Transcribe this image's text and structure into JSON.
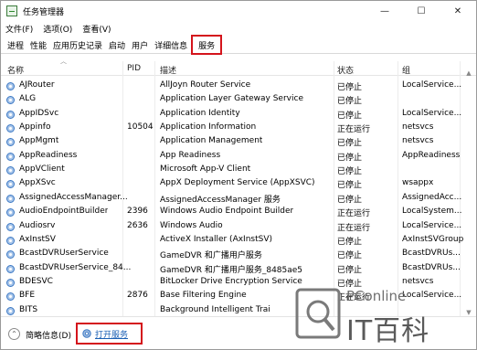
{
  "window": {
    "title": "任务管理器",
    "controls": [
      "—",
      "☐",
      "✕"
    ]
  },
  "menu": [
    "文件(F)",
    "选项(O)",
    "查看(V)"
  ],
  "tabs": [
    {
      "label": "进程",
      "active": false
    },
    {
      "label": "性能",
      "active": false
    },
    {
      "label": "应用历史记录",
      "active": false
    },
    {
      "label": "启动",
      "active": false
    },
    {
      "label": "用户",
      "active": false
    },
    {
      "label": "详细信息",
      "active": false
    },
    {
      "label": "服务",
      "active": true
    }
  ],
  "columns": {
    "name": "名称",
    "pid": "PID",
    "desc": "描述",
    "status": "状态",
    "group": "组"
  },
  "rows": [
    {
      "name": "AJRouter",
      "pid": "",
      "desc": "AllJoyn Router Service",
      "status": "已停止",
      "group": "LocalService..."
    },
    {
      "name": "ALG",
      "pid": "",
      "desc": "Application Layer Gateway Service",
      "status": "已停止",
      "group": ""
    },
    {
      "name": "AppIDSvc",
      "pid": "",
      "desc": "Application Identity",
      "status": "已停止",
      "group": "LocalService..."
    },
    {
      "name": "Appinfo",
      "pid": "10504",
      "desc": "Application Information",
      "status": "正在运行",
      "group": "netsvcs"
    },
    {
      "name": "AppMgmt",
      "pid": "",
      "desc": "Application Management",
      "status": "已停止",
      "group": "netsvcs"
    },
    {
      "name": "AppReadiness",
      "pid": "",
      "desc": "App Readiness",
      "status": "已停止",
      "group": "AppReadiness"
    },
    {
      "name": "AppVClient",
      "pid": "",
      "desc": "Microsoft App-V Client",
      "status": "已停止",
      "group": ""
    },
    {
      "name": "AppXSvc",
      "pid": "",
      "desc": "AppX Deployment Service (AppXSVC)",
      "status": "已停止",
      "group": "wsappx"
    },
    {
      "name": "AssignedAccessManager...",
      "pid": "",
      "desc": "AssignedAccessManager 服务",
      "status": "已停止",
      "group": "AssignedAcc..."
    },
    {
      "name": "AudioEndpointBuilder",
      "pid": "2396",
      "desc": "Windows Audio Endpoint Builder",
      "status": "正在运行",
      "group": "LocalSystem..."
    },
    {
      "name": "Audiosrv",
      "pid": "2636",
      "desc": "Windows Audio",
      "status": "正在运行",
      "group": "LocalService..."
    },
    {
      "name": "AxInstSV",
      "pid": "",
      "desc": "ActiveX Installer (AxInstSV)",
      "status": "已停止",
      "group": "AxInstSVGroup"
    },
    {
      "name": "BcastDVRUserService",
      "pid": "",
      "desc": "GameDVR 和广播用户服务",
      "status": "已停止",
      "group": "BcastDVRUs..."
    },
    {
      "name": "BcastDVRUserService_84...",
      "pid": "",
      "desc": "GameDVR 和广播用户服务_8485ae5",
      "status": "已停止",
      "group": "BcastDVRUs..."
    },
    {
      "name": "BDESVC",
      "pid": "",
      "desc": "BitLocker Drive Encryption Service",
      "status": "已停止",
      "group": "netsvcs"
    },
    {
      "name": "BFE",
      "pid": "2876",
      "desc": "Base Filtering Engine",
      "status": "正在运行",
      "group": "LocalService..."
    },
    {
      "name": "BITS",
      "pid": "",
      "desc": "Background Intelligent Trai",
      "status": "",
      "group": ""
    }
  ],
  "footer": {
    "toggle_icon": "⌃",
    "brief_label": "简略信息(D)",
    "open_services_label": "打开服务"
  },
  "watermark": {
    "en": "PConline",
    "cn": "IT百科"
  },
  "colors": {
    "highlight_red": "#d4141c",
    "link_blue": "#1a5fb4",
    "gear_blue": "#3b78c4"
  }
}
